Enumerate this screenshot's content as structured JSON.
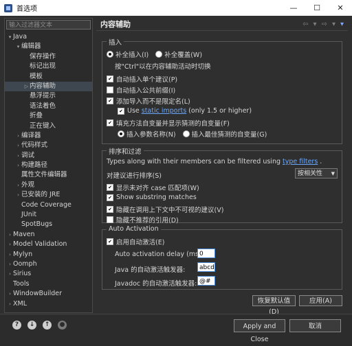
{
  "window": {
    "title": "首选项",
    "minimize": "—",
    "maximize": "☐",
    "close": "✕"
  },
  "filter": {
    "placeholder": "输入过滤器文本"
  },
  "tree": [
    {
      "label": "Java",
      "arrow": "▾",
      "indent": 0
    },
    {
      "label": "编辑器",
      "arrow": "▾",
      "indent": 1
    },
    {
      "label": "保存操作",
      "arrow": "",
      "indent": 2
    },
    {
      "label": "标记出现",
      "arrow": "",
      "indent": 2
    },
    {
      "label": "模板",
      "arrow": "",
      "indent": 2
    },
    {
      "label": "内容辅助",
      "arrow": "▷",
      "indent": 2,
      "selected": true
    },
    {
      "label": "悬浮提示",
      "arrow": "",
      "indent": 2
    },
    {
      "label": "语法着色",
      "arrow": "",
      "indent": 2
    },
    {
      "label": "折叠",
      "arrow": "",
      "indent": 2
    },
    {
      "label": "正在键入",
      "arrow": "",
      "indent": 2
    },
    {
      "label": "编译器",
      "arrow": "›",
      "indent": 1
    },
    {
      "label": "代码样式",
      "arrow": "›",
      "indent": 1
    },
    {
      "label": "调试",
      "arrow": "›",
      "indent": 1
    },
    {
      "label": "构建路径",
      "arrow": "›",
      "indent": 1
    },
    {
      "label": "属性文件编辑器",
      "arrow": "",
      "indent": 1
    },
    {
      "label": "外观",
      "arrow": "›",
      "indent": 1
    },
    {
      "label": "已安装的 JRE",
      "arrow": "›",
      "indent": 1
    },
    {
      "label": "Code Coverage",
      "arrow": "",
      "indent": 1
    },
    {
      "label": "JUnit",
      "arrow": "",
      "indent": 1
    },
    {
      "label": "SpotBugs",
      "arrow": "",
      "indent": 1
    },
    {
      "label": "Maven",
      "arrow": "›",
      "indent": 0
    },
    {
      "label": "Model Validation",
      "arrow": "›",
      "indent": 0
    },
    {
      "label": "Mylyn",
      "arrow": "›",
      "indent": 0
    },
    {
      "label": "Oomph",
      "arrow": "›",
      "indent": 0
    },
    {
      "label": "Sirius",
      "arrow": "›",
      "indent": 0
    },
    {
      "label": "Tools",
      "arrow": "",
      "indent": 0
    },
    {
      "label": "WindowBuilder",
      "arrow": "›",
      "indent": 0
    },
    {
      "label": "XML",
      "arrow": "›",
      "indent": 0
    }
  ],
  "page": {
    "title": "内容辅助"
  },
  "insertion": {
    "label": "插入",
    "radio_insert": "补全插入(I)",
    "radio_overwrite": "补全覆盖(W)",
    "hint": "按\"Ctrl\"以在内容辅助活动时切换",
    "auto_single": "自动插入单个建议(P)",
    "auto_common": "自动插入公共前缀(I)",
    "add_import": "添加导入而不是限定名(L)",
    "use_prefix": "Use",
    "use_link": "static imports",
    "use_suffix": "(only 1.5 or higher)",
    "fill_args": "填充方法自变量并显示猜测的自变量(F)",
    "insert_names": "插入参数名称(N)",
    "insert_best": "插入最佳猜测的自变量(G)"
  },
  "sorting": {
    "label": "排序和过滤",
    "desc_prefix": "Types along with their members can be filtered using",
    "desc_link": "type filters",
    "desc_suffix": ".",
    "sort_label": "对建议进行排序(S)",
    "sort_value": "按相关性",
    "show_camel": "显示未对齐 case 匹配项(W)",
    "show_substring": "Show substring matches",
    "hide_hidden": "隐藏在调用上下文中不可视的建议(V)",
    "hide_deprecated": "隐藏不推荐的引用(D)"
  },
  "auto": {
    "label": "Auto Activation",
    "enable": "启用自动激活(E)",
    "delay_label": "Auto activation delay (ms):",
    "delay_value": "0",
    "java_label": "Java 的自动激活触发器:",
    "java_value": "abcdefghijklmnopqrstuvwxyz.",
    "javadoc_label": "Javadoc 的自动激活触发器:",
    "javadoc_value": "@#"
  },
  "buttons": {
    "restore": "恢复默认值(D)",
    "apply": "应用(A)",
    "apply_close": "Apply and Close",
    "cancel": "取消"
  }
}
